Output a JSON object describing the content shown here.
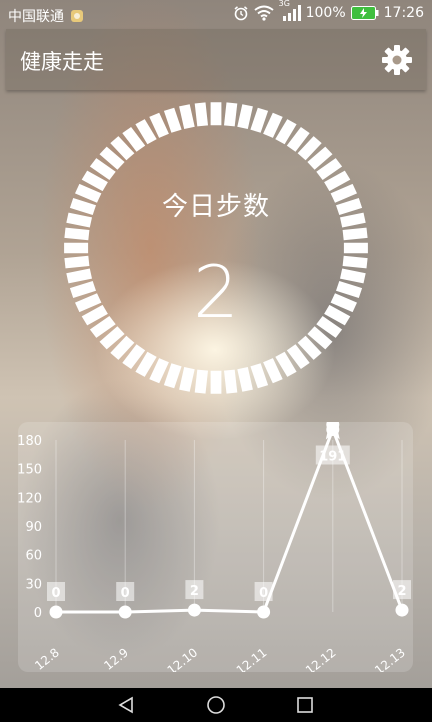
{
  "status_bar": {
    "carrier": "中国联通",
    "network": "3G",
    "battery": "100%",
    "time": "17:26",
    "icons": [
      "notification-icon",
      "alarm-icon",
      "wifi-icon",
      "signal-icon",
      "battery-charging-icon"
    ]
  },
  "header": {
    "title": "健康走走",
    "settings_icon": "gear-icon"
  },
  "today": {
    "label": "今日步数",
    "steps": "2"
  },
  "chart_data": {
    "type": "line",
    "categories": [
      "12.8",
      "12.9",
      "12.10",
      "12.11",
      "12.12",
      "12.13"
    ],
    "values": [
      0,
      0,
      2,
      0,
      191,
      2
    ],
    "data_labels": [
      "0",
      "0",
      "2",
      "0",
      "191",
      "2"
    ],
    "yticks": [
      0,
      30,
      60,
      90,
      120,
      150,
      180
    ],
    "ylim": [
      0,
      180
    ],
    "max_marker_icon": "award-icon",
    "line_color": "#ffffff",
    "grid": true
  },
  "nav_bar": {
    "back_icon": "back-triangle-icon",
    "home_icon": "home-circle-icon",
    "recents_icon": "recents-square-icon"
  }
}
